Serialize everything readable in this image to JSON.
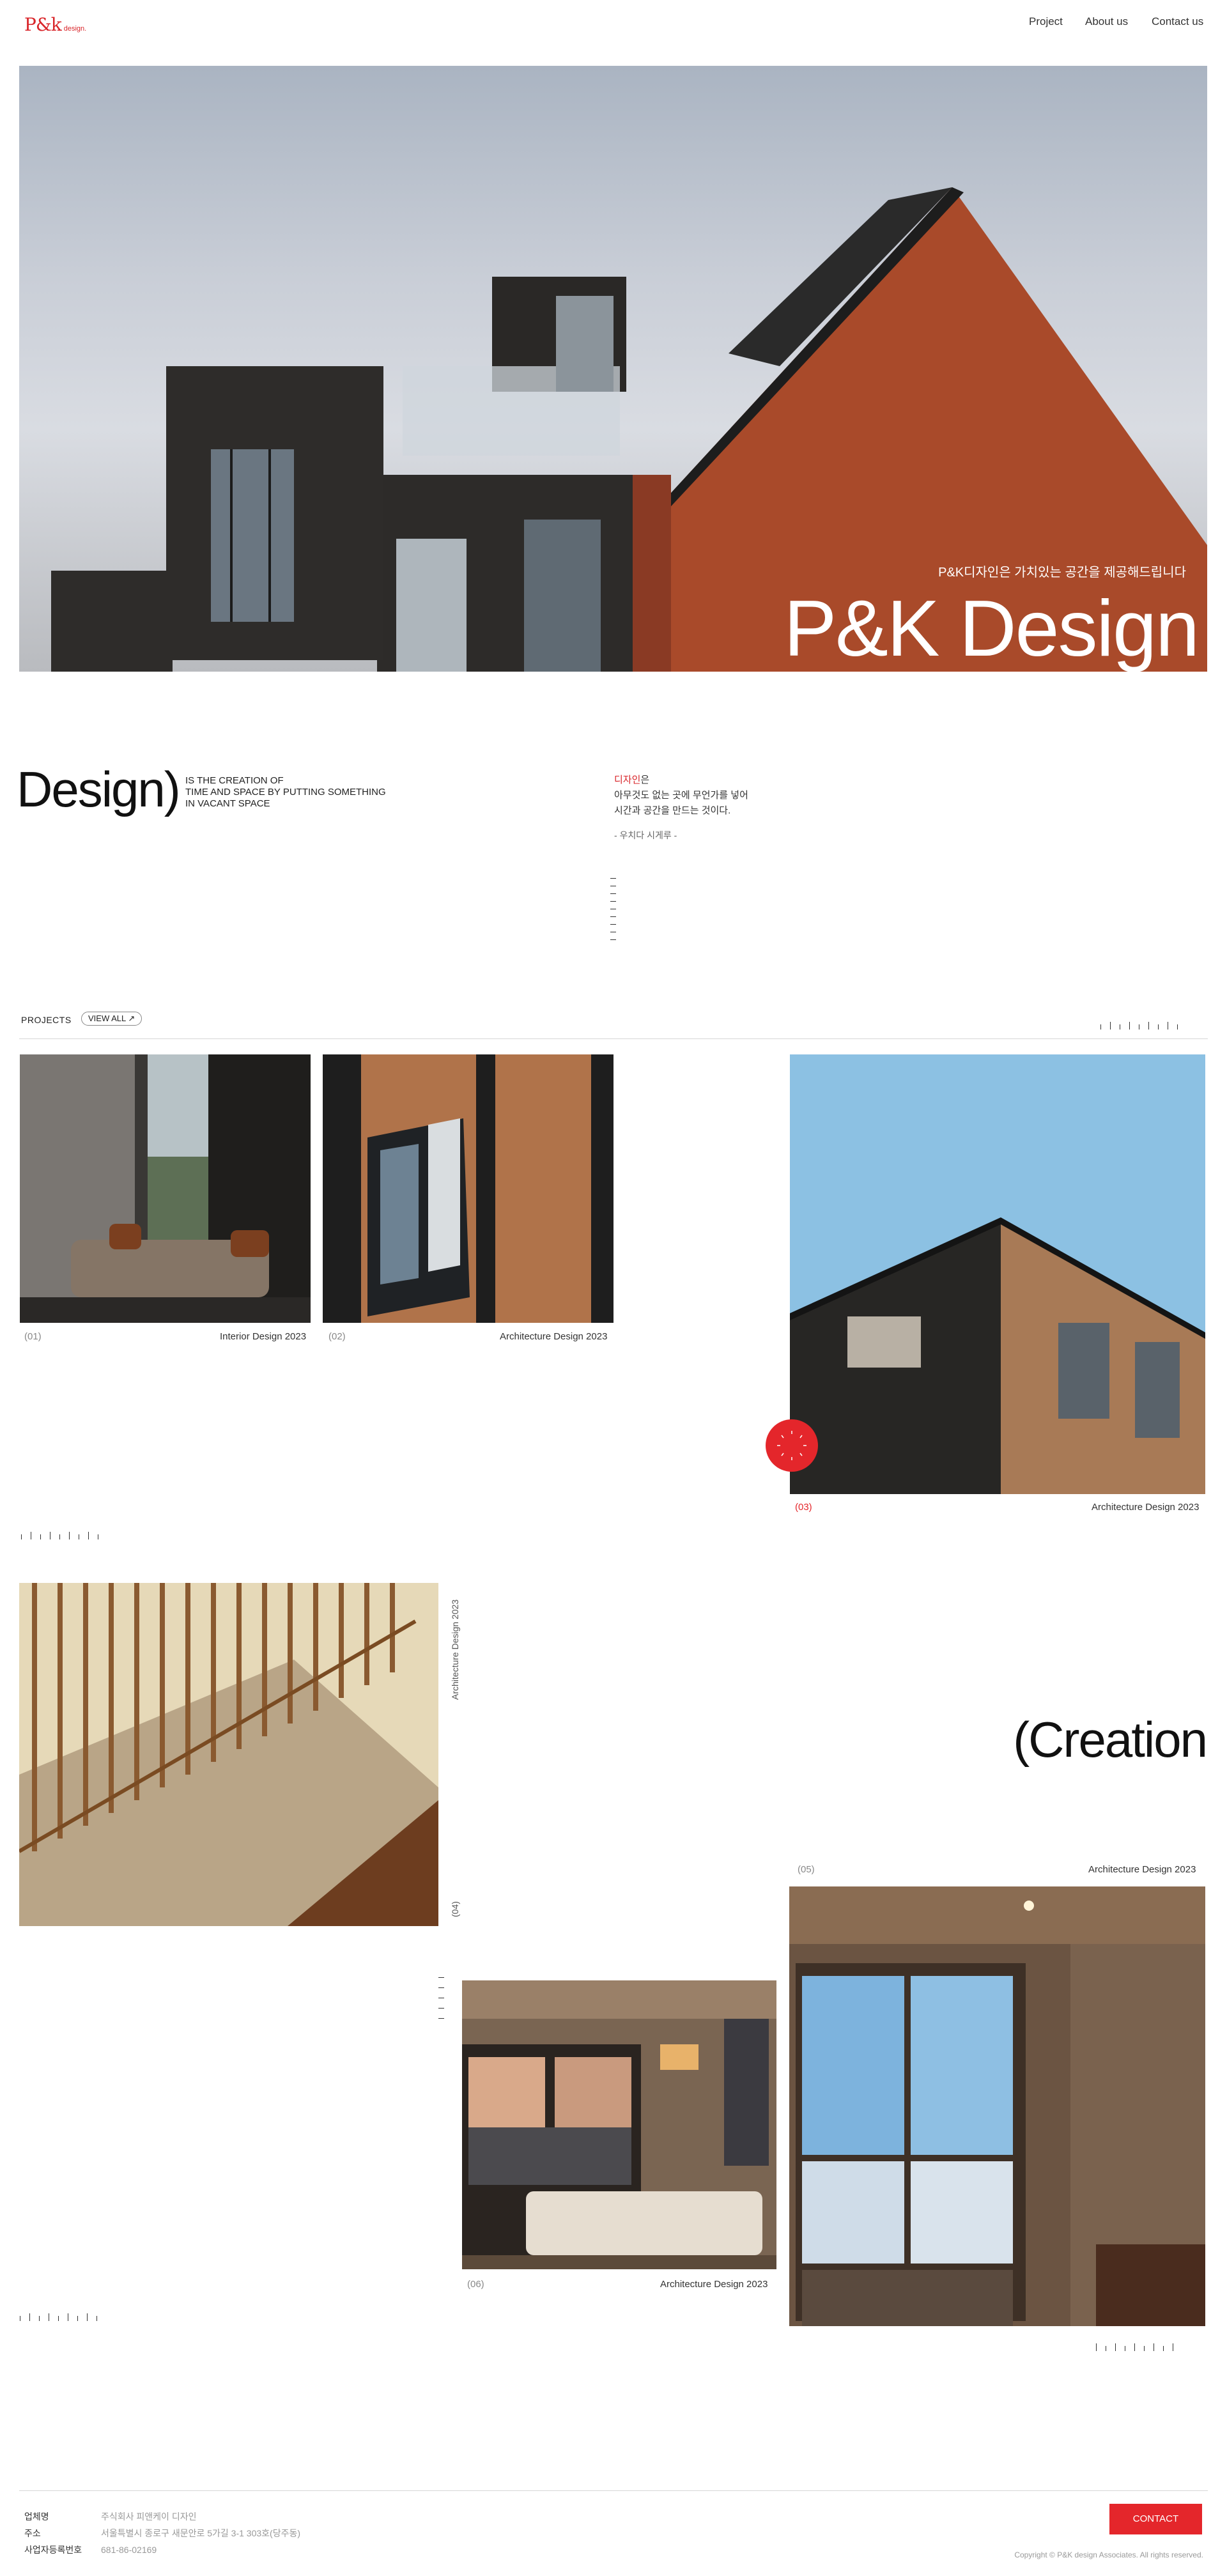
{
  "header": {
    "logo_text": "P&k",
    "logo_sub": "design.",
    "nav": [
      "Project",
      "About us",
      "Contact us"
    ]
  },
  "hero": {
    "subtitle": "P&K디자인은 가치있는 공간을 제공해드립니다",
    "title": "P&K Design"
  },
  "intro": {
    "big_word": "Design)",
    "en_lines": [
      "IS THE CREATION OF",
      "TIME AND SPACE BY PUTTING SOMETHING",
      "IN VACANT SPACE"
    ],
    "kr_accent": "디자인",
    "kr_accent_suffix": "은",
    "kr_lines": [
      "아무것도 없는 곳에 무언가를 넣어",
      "시간과 공간을 만드는 것이다."
    ],
    "kr_quote": "- 우치다 시게루 -"
  },
  "projects": {
    "label": "PROJECTS",
    "view_all": "VIEW ALL",
    "items": [
      {
        "num": "(01)",
        "caption": "Interior Design 2023"
      },
      {
        "num": "(02)",
        "caption": "Architecture Design 2023"
      },
      {
        "num": "(03)",
        "caption": "Architecture Design 2023"
      },
      {
        "num": "(04)",
        "caption": "Architecture Design 2023"
      },
      {
        "num": "(05)",
        "caption": "Architecture Design 2023"
      },
      {
        "num": "(06)",
        "caption": "Architecture Design 2023"
      }
    ],
    "creation_word": "(Creation"
  },
  "footer": {
    "rows": [
      {
        "key": "업체명",
        "value": "주식회사 피앤케이 디자인"
      },
      {
        "key": "주소",
        "value": "서울특별시 종로구 새문안로 5가길 3-1 303호(당주동)"
      },
      {
        "key": "사업자등록번호",
        "value": "681-86-02169"
      }
    ],
    "contact_label": "CONTACT",
    "copyright": "Copyright © P&K design Associates. All rights reserved."
  },
  "colors": {
    "accent": "#e4262b",
    "brand_red": "#d9262b"
  }
}
